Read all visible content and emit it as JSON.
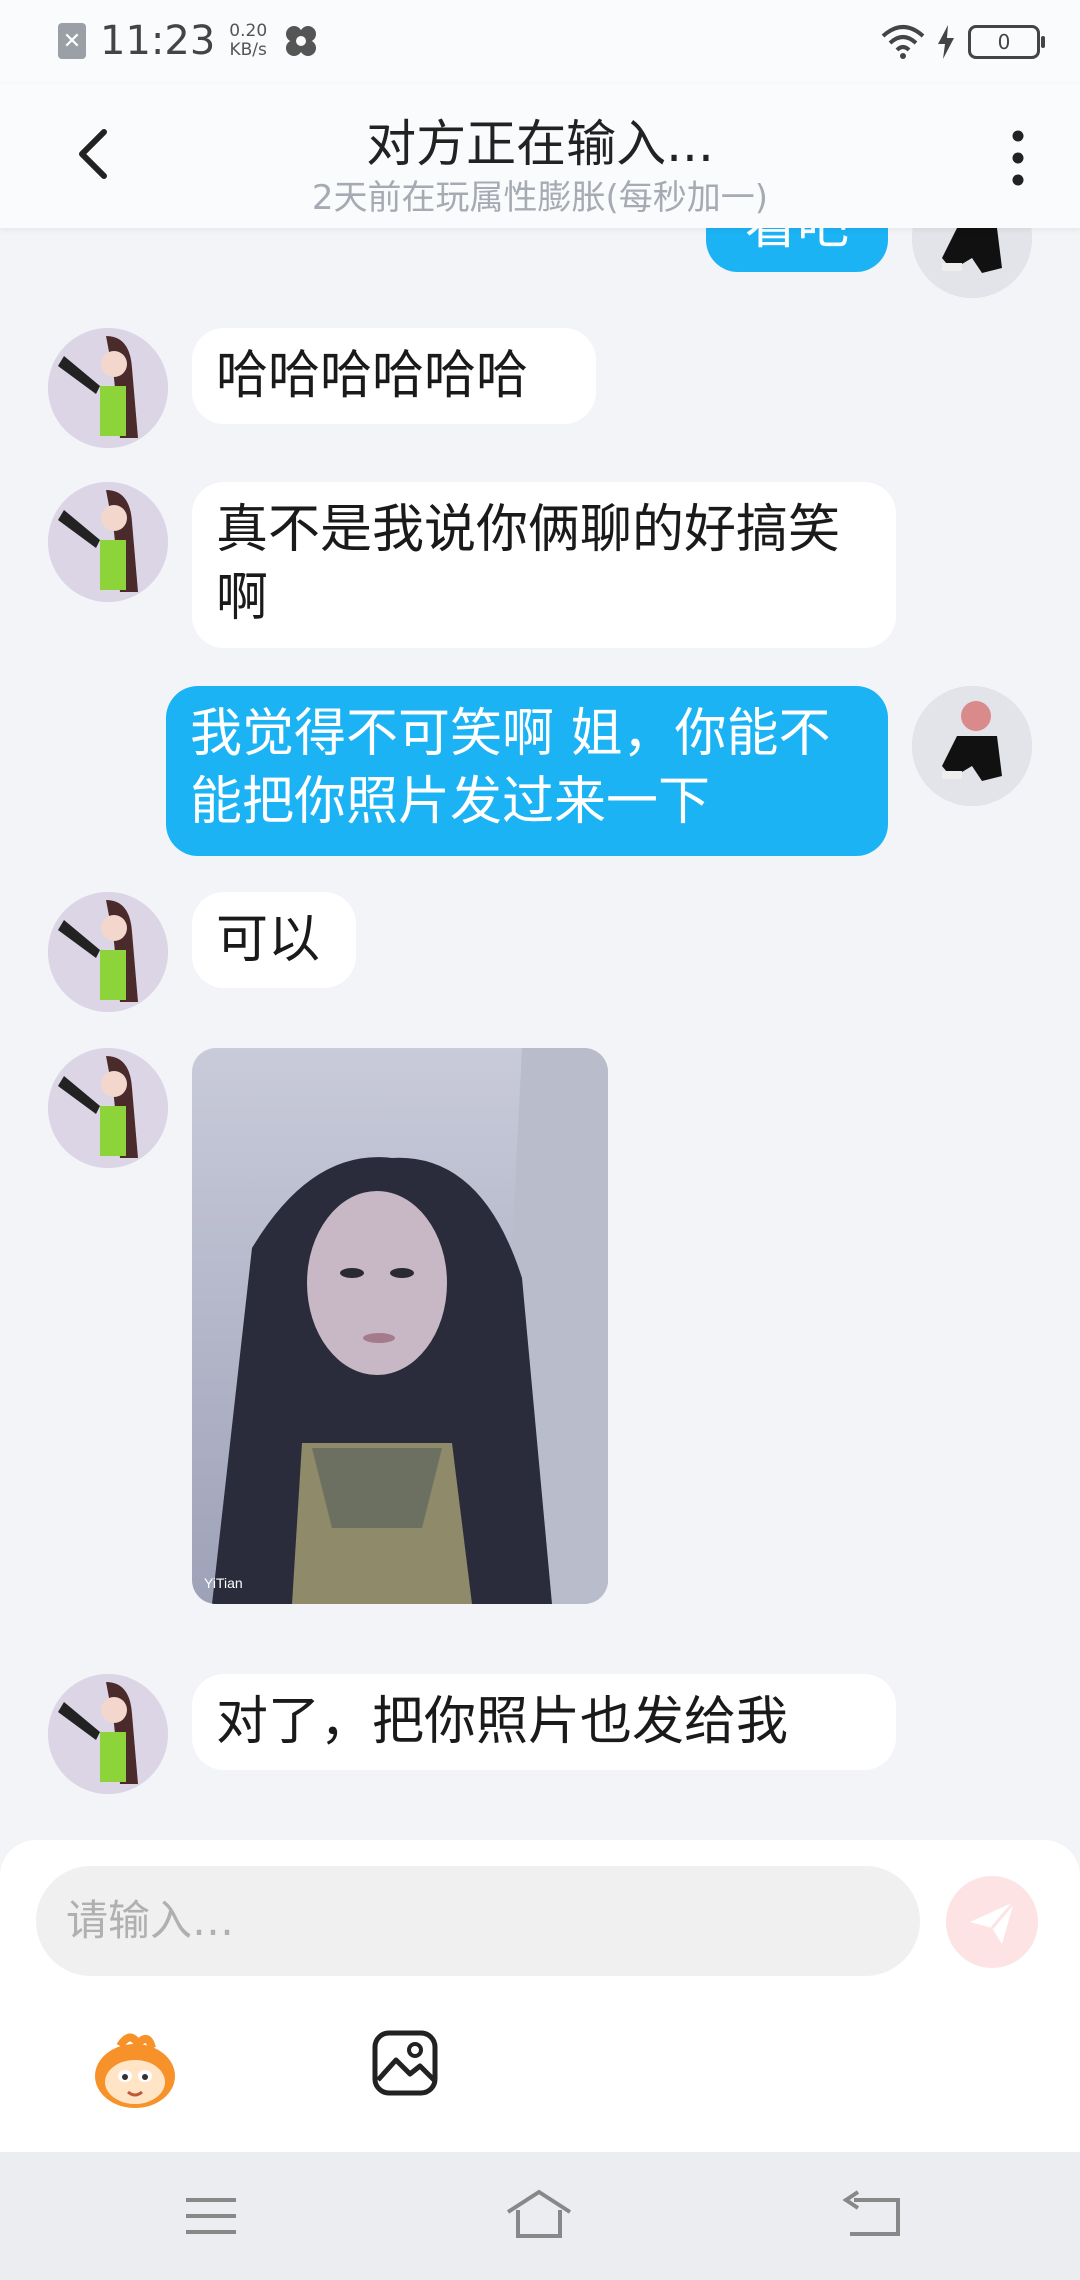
{
  "status": {
    "time": "11:23",
    "speed_value": "0.20",
    "speed_unit": "KB/s",
    "battery": "0"
  },
  "header": {
    "title": "对方正在输入...",
    "subtitle": "2天前在玩属性膨胀(每秒加一)"
  },
  "messages": [
    {
      "side": "out",
      "text": "看吧"
    },
    {
      "side": "in",
      "text": "哈哈哈哈哈哈"
    },
    {
      "side": "in",
      "text": "真不是我说你俩聊的好搞笑啊"
    },
    {
      "side": "out",
      "text": "我觉得不可笑啊 姐，你能不能把你照片发过来一下"
    },
    {
      "side": "in",
      "text": "可以"
    },
    {
      "side": "in",
      "type": "image",
      "watermark": "YiTian"
    },
    {
      "side": "in",
      "text": "对了，把你照片也发给我"
    }
  ],
  "input": {
    "placeholder": "请输入…"
  },
  "colors": {
    "outgoing_bubble": "#1cb3f5",
    "incoming_bubble": "#ffffff",
    "background": "#f2f4f8",
    "send_button": "#fde3e3"
  },
  "icons": [
    "back-icon",
    "more-icon",
    "send-icon",
    "emoji-icon",
    "image-icon",
    "menu-icon",
    "home-icon",
    "back-nav-icon"
  ]
}
